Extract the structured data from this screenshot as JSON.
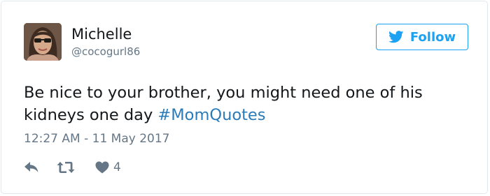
{
  "user": {
    "display_name": "Michelle",
    "screen_name": "@cocogurl86",
    "avatar_icon": "user-avatar-photo"
  },
  "follow_button": {
    "label": "Follow",
    "icon": "twitter-bird-icon",
    "accent_color": "#1da1f2"
  },
  "tweet": {
    "text": "Be nice to your brother, you might need one of his kidneys one day ",
    "hashtag": "#MomQuotes",
    "hashtag_color": "#2b7bb9",
    "timestamp": "12:27 AM - 11 May 2017"
  },
  "actions": {
    "reply_icon": "reply-icon",
    "retweet_icon": "retweet-icon",
    "like_icon": "heart-icon",
    "like_count": "4"
  }
}
